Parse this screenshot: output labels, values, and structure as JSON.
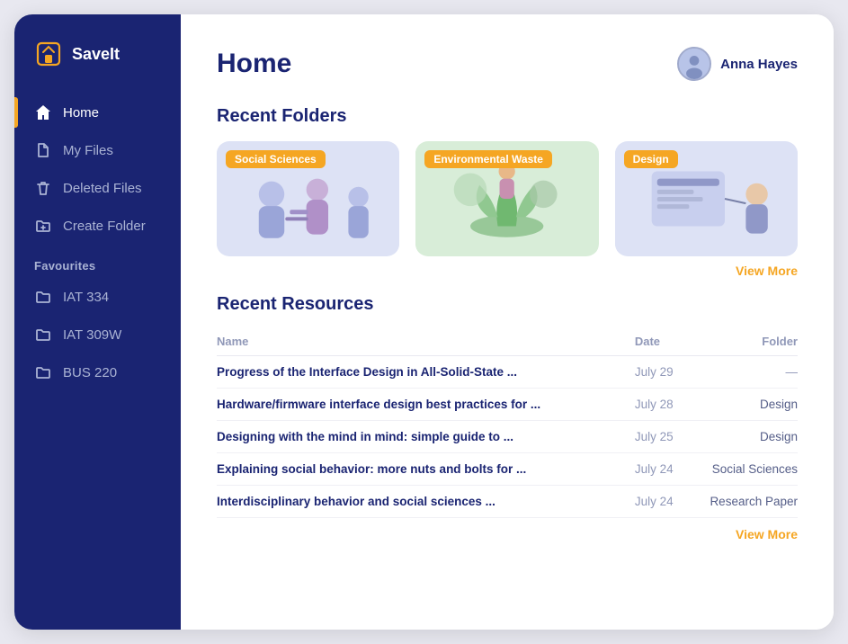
{
  "app": {
    "logo_text": "SaveIt",
    "title": "Home"
  },
  "sidebar": {
    "nav_items": [
      {
        "label": "Home",
        "icon": "home-icon",
        "active": true
      },
      {
        "label": "My Files",
        "icon": "files-icon",
        "active": false
      },
      {
        "label": "Deleted Files",
        "icon": "trash-icon",
        "active": false
      },
      {
        "label": "Create Folder",
        "icon": "folder-plus-icon",
        "active": false
      }
    ],
    "favourites_label": "Favourites",
    "favourites_items": [
      {
        "label": "IAT 334",
        "icon": "folder-icon"
      },
      {
        "label": "IAT 309W",
        "icon": "folder-icon"
      },
      {
        "label": "BUS 220",
        "icon": "folder-icon"
      }
    ]
  },
  "user": {
    "name": "Anna Hayes"
  },
  "recent_folders": {
    "section_title": "Recent Folders",
    "view_more": "View More",
    "folders": [
      {
        "label": "Social Sciences",
        "card_class": "card-social"
      },
      {
        "label": "Environmental Waste",
        "card_class": "card-env"
      },
      {
        "label": "Design",
        "card_class": "card-design"
      }
    ]
  },
  "recent_resources": {
    "section_title": "Recent Resources",
    "view_more": "View More",
    "columns": {
      "name": "Name",
      "date": "Date",
      "folder": "Folder"
    },
    "rows": [
      {
        "name": "Progress of the Interface Design in All-Solid-State ...",
        "date": "July 29",
        "folder": "—",
        "folder_type": "dash"
      },
      {
        "name": "Hardware/firmware interface design best practices for ...",
        "date": "July 28",
        "folder": "Design",
        "folder_type": "text"
      },
      {
        "name": "Designing with the mind in mind: simple guide to ...",
        "date": "July 25",
        "folder": "Design",
        "folder_type": "text"
      },
      {
        "name": "Explaining social behavior: more nuts and bolts for ...",
        "date": "July 24",
        "folder": "Social Sciences",
        "folder_type": "text"
      },
      {
        "name": "Interdisciplinary behavior and social sciences ...",
        "date": "July 24",
        "folder": "Research Paper",
        "folder_type": "text"
      }
    ]
  }
}
